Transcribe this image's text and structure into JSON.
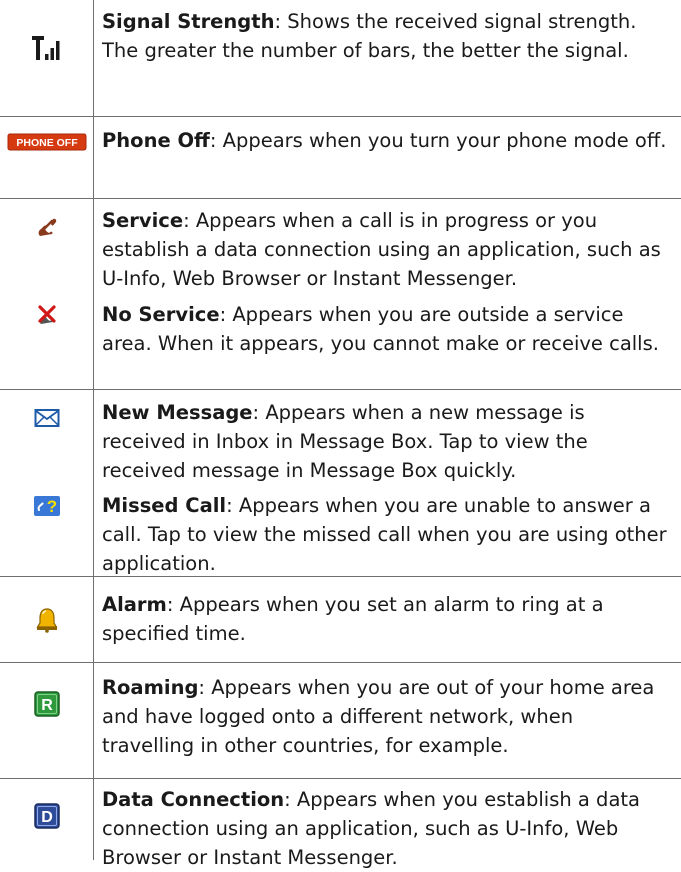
{
  "entries": [
    {
      "icon": "signal-strength-icon",
      "term": "Signal Strength",
      "desc": ": Shows the received signal strength. The greater the number of bars, the better the signal."
    },
    {
      "icon": "phone-off-icon",
      "icon_text": "PHONE OFF",
      "term": "Phone Off",
      "desc": ": Appears when you turn your phone mode off."
    },
    {
      "icon": "service-handset-icon",
      "term": "Service",
      "desc": ": Appears when a call is in progress or you establish a data connection using an application, such as U-Info, Web Browser or Instant Messenger."
    },
    {
      "icon": "no-service-icon",
      "term": "No Service",
      "desc": ": Appears when you are outside a service area. When it appears, you cannot make or receive calls."
    },
    {
      "icon": "envelope-icon",
      "term": "New Message",
      "desc": ": Appears when a new message is received in Inbox in Message Box. Tap to view the received message in Message Box quickly."
    },
    {
      "icon": "missed-call-icon",
      "term": "Missed Call",
      "desc": ": Appears when you are unable to answer a call. Tap to view the missed call when you are using other application."
    },
    {
      "icon": "alarm-bell-icon",
      "term": "Alarm",
      "desc": ": Appears when you set an alarm to ring at a specified time."
    },
    {
      "icon": "roaming-icon",
      "icon_text": "R",
      "term": "Roaming",
      "desc": ": Appears when you are out of your home area and have logged onto a different network, when travelling in other countries, for example."
    },
    {
      "icon": "data-connection-icon",
      "icon_text": "D",
      "term": "Data Connection",
      "desc": ": Appears when you establish a data connection using an application, such as U-Info, Web Browser or Instant Messenger."
    }
  ],
  "colors": {
    "rule": "#6f6f6f",
    "phone_off_bg": "#d63a10",
    "handset": "#8a3a1c",
    "cross": "#d01818",
    "envelope": "#1d5aa8",
    "bell": "#f0b400",
    "roaming_bg": "#2e9a3c",
    "data_bg": "#2f4c9a"
  }
}
